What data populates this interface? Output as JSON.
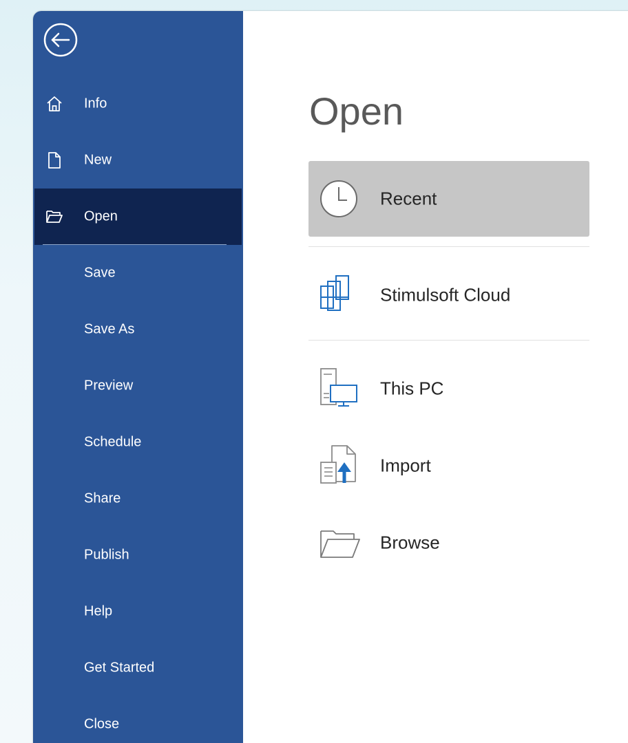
{
  "sidebar": {
    "items": [
      {
        "label": "Info",
        "icon": "home-icon"
      },
      {
        "label": "New",
        "icon": "new-document-icon"
      },
      {
        "label": "Open",
        "icon": "folder-open-icon"
      },
      {
        "label": "Save"
      },
      {
        "label": "Save As"
      },
      {
        "label": "Preview"
      },
      {
        "label": "Schedule"
      },
      {
        "label": "Share"
      },
      {
        "label": "Publish"
      },
      {
        "label": "Help"
      },
      {
        "label": "Get Started"
      },
      {
        "label": "Close"
      }
    ],
    "active_item": "Open"
  },
  "main": {
    "title": "Open",
    "locations": [
      {
        "label": "Recent",
        "icon": "clock-icon",
        "selected": true
      },
      {
        "label": "Stimulsoft Cloud",
        "icon": "cloud-windows-icon"
      },
      {
        "label": "This PC",
        "icon": "computer-icon"
      },
      {
        "label": "Import",
        "icon": "import-icon"
      },
      {
        "label": "Browse",
        "icon": "folder-icon"
      }
    ]
  },
  "colors": {
    "sidebar_background": "#2b5597",
    "sidebar_active": "#0f2450",
    "selected_location": "#c6c6c6",
    "accent_blue": "#1f6fc1"
  }
}
